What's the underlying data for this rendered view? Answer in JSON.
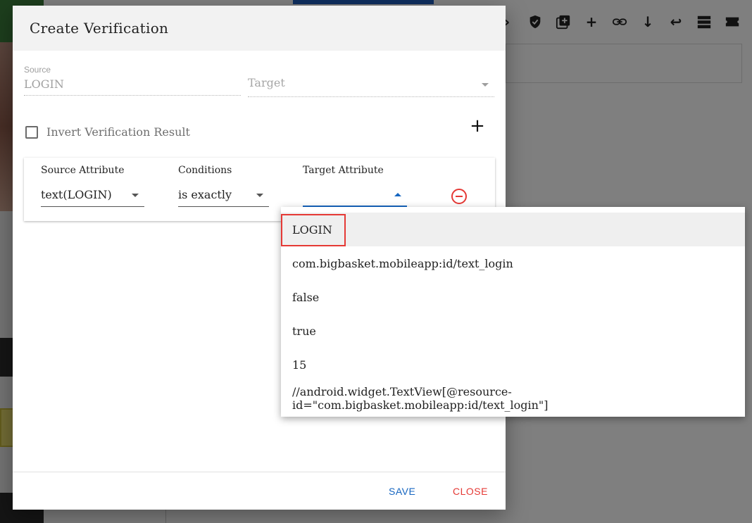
{
  "dialog": {
    "title": "Create Verification",
    "source_label": "Source",
    "source_value": "LOGIN",
    "target_placeholder": "Target",
    "invert_label": "Invert Verification Result",
    "add_icon": "plus-icon",
    "columns": {
      "source_attribute": "Source Attribute",
      "conditions": "Conditions",
      "target_attribute": "Target Attribute"
    },
    "row": {
      "source_attribute_value": "text(LOGIN)",
      "condition_value": "is exactly",
      "target_attribute_value": "",
      "remove_icon": "remove-circle-icon"
    },
    "save_label": "SAVE",
    "close_label": "CLOSE"
  },
  "dropdown": {
    "options": [
      "LOGIN",
      "com.bigbasket.mobileapp:id/text_login",
      "false",
      "true",
      "15",
      "//android.widget.TextView[@resource-id=\"com.bigbasket.mobileapp:id/text_login\"]"
    ],
    "highlighted_index": 0
  },
  "colors": {
    "accent": "#1565c0",
    "danger": "#e53935",
    "header_bg": "#f2f2f2"
  },
  "toolbar_icons": [
    "arrow-right-icon",
    "shield-check-icon",
    "add-box-icon",
    "plus-icon",
    "link-icon",
    "arrow-down-icon",
    "return-icon",
    "list-icon",
    "ticket-icon"
  ]
}
